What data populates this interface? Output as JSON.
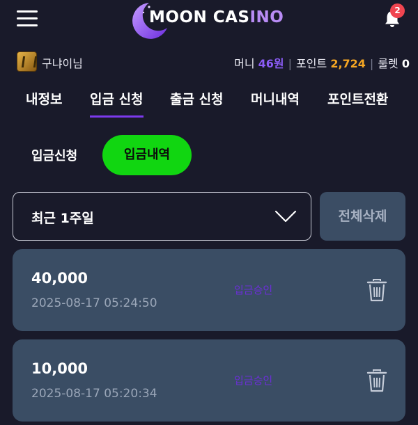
{
  "header": {
    "logo_text_main": "MOON CAS",
    "logo_text_accent": "INO",
    "notification_count": "2"
  },
  "user": {
    "name": "구냐이님",
    "money_label": "머니",
    "money_value": "46원",
    "point_label": "포인트",
    "point_value": "2,724",
    "roulette_label": "룰렛",
    "roulette_value": "0"
  },
  "tabs": [
    {
      "label": "내정보"
    },
    {
      "label": "입금 신청"
    },
    {
      "label": "출금 신청"
    },
    {
      "label": "머니내역"
    },
    {
      "label": "포인트전환"
    }
  ],
  "subtabs": {
    "request": "입금신청",
    "history": "입금내역"
  },
  "filter": {
    "period": "최근 1주일",
    "delete_all": "전체삭제"
  },
  "records": [
    {
      "amount": "40,000",
      "datetime": "2025-08-17 05:24:50",
      "status": "입금승인"
    },
    {
      "amount": "10,000",
      "datetime": "2025-08-17 05:20:34",
      "status": "입금승인"
    }
  ],
  "colors": {
    "background": "#191a2a",
    "accent_purple": "#7c3aed",
    "active_green": "#11d611",
    "card": "#3a4d64",
    "point_orange": "#f5a623"
  }
}
